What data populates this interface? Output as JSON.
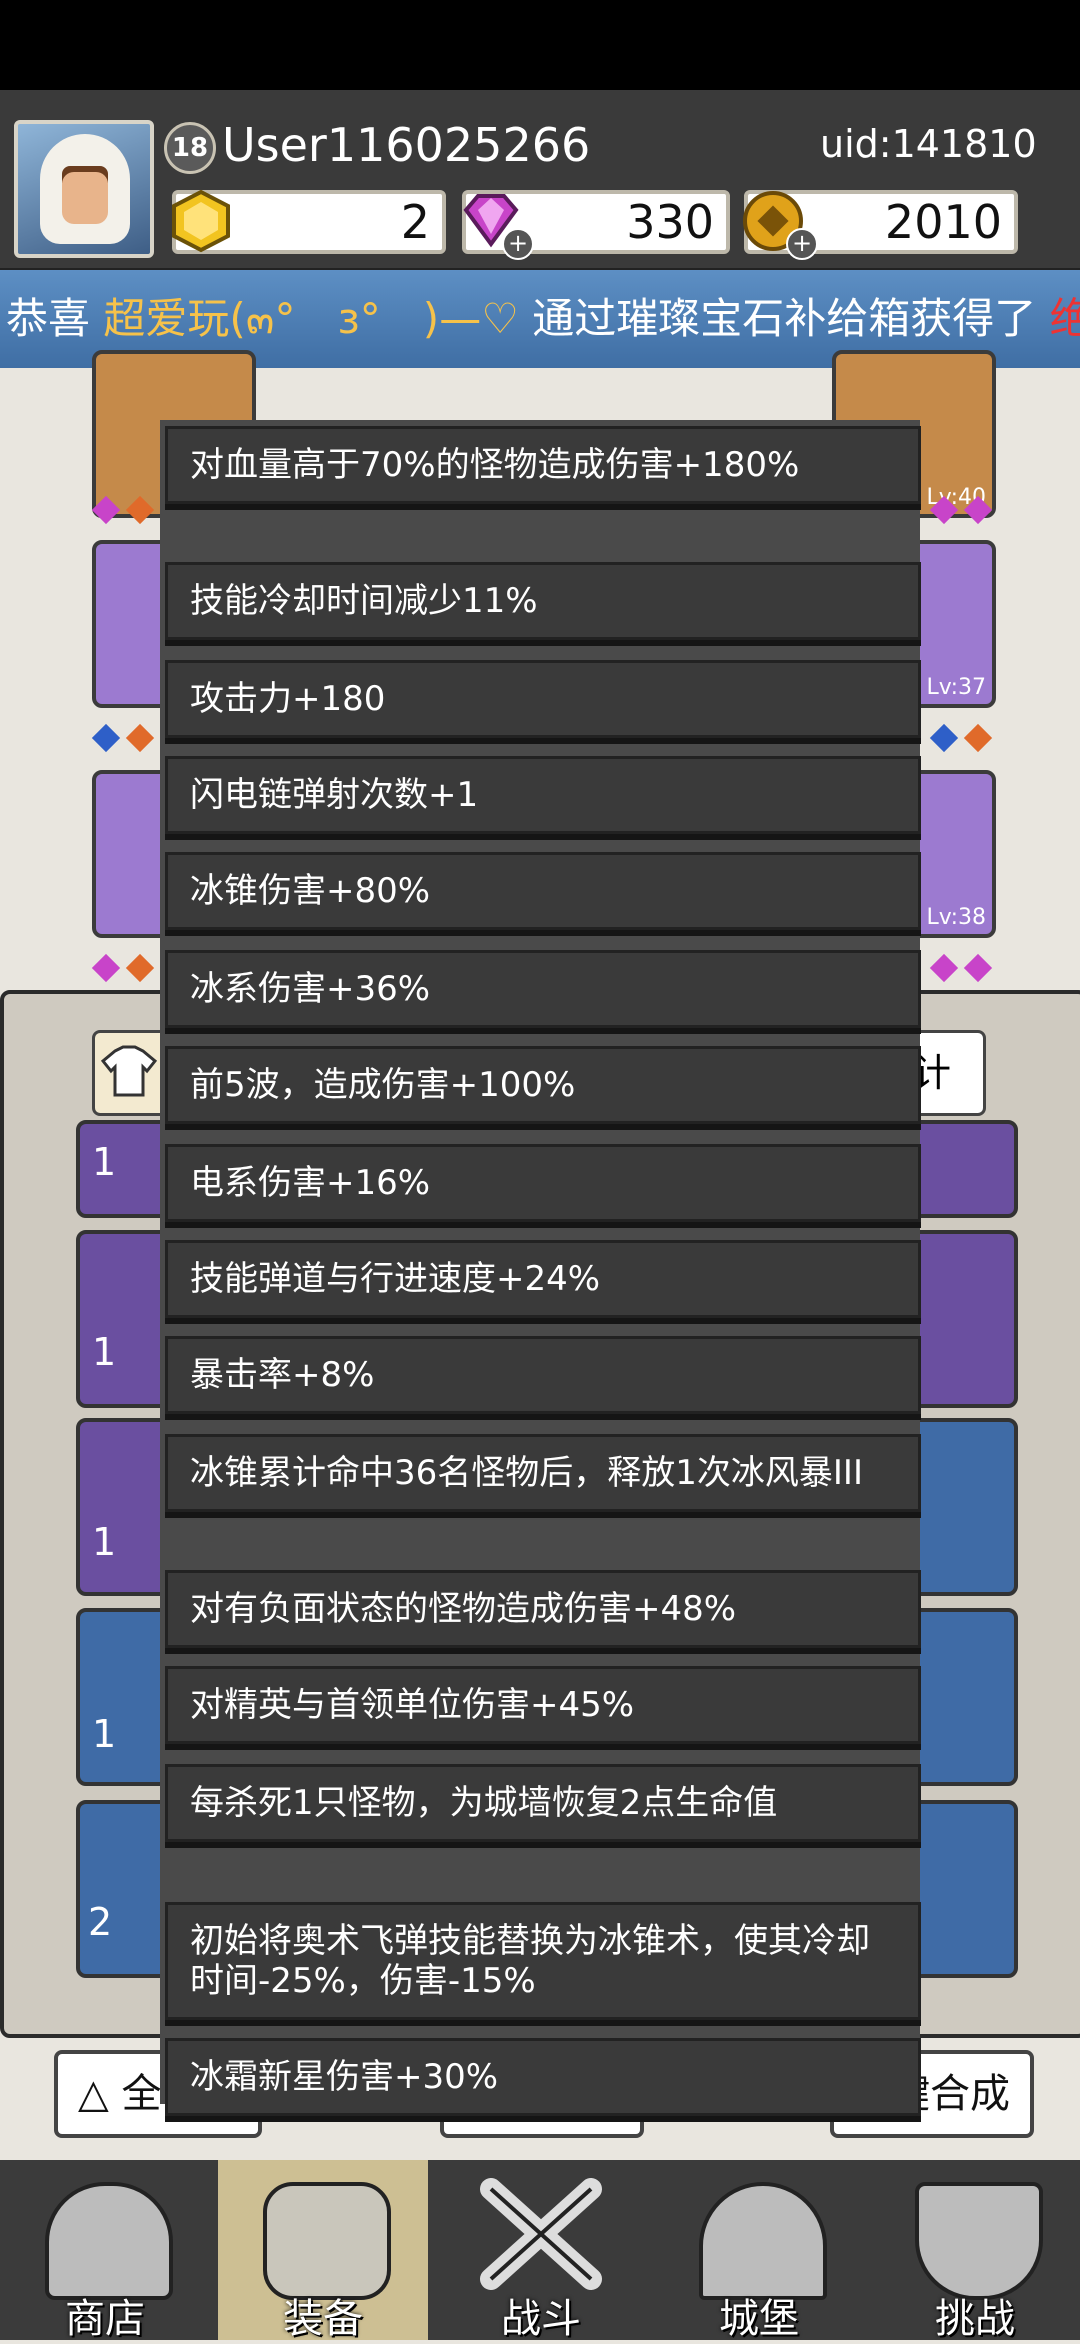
{
  "header": {
    "level": "18",
    "username": "User116025266",
    "uid": "uid:141810",
    "resources": {
      "gold_gem": "2",
      "diamond": "330",
      "coin": "2010"
    },
    "colors": {
      "gold": "#f2c420",
      "diamond": "#c844c9",
      "coin": "#e0a21a"
    }
  },
  "marquee": {
    "prefix": "恭喜",
    "player": "超爱玩(๓°　з°　)—♡",
    "suffix": "通过璀璨宝石补给箱获得了",
    "tail": "绝"
  },
  "equipment_levels": [
    "Lv:40",
    "Lv:37",
    "Lv:38"
  ],
  "panel_partial": {
    "right_tab": "计",
    "bottom_right": "键合成",
    "bottom_left": "全部"
  },
  "inventory_counts": [
    "1",
    "1",
    "1",
    "1",
    "2"
  ],
  "attributes": [
    "对血量高于70%的怪物造成伤害+180%",
    "技能冷却时间减少11%",
    "攻击力+180",
    "闪电链弹射次数+1",
    "冰锥伤害+80%",
    "冰系伤害+36%",
    "前5波，造成伤害+100%",
    "电系伤害+16%",
    "技能弹道与行进速度+24%",
    "暴击率+8%",
    "冰锥累计命中36名怪物后，释放1次冰风暴III",
    "对有负面状态的怪物造成伤害+48%",
    "对精英与首领单位伤害+45%",
    "每杀死1只怪物，为城墙恢复2点生命值",
    "初始将奥术飞弹技能替换为冰锥术，使其冷却时间-25%，伤害-15%",
    "冰霜新星伤害+30%"
  ],
  "nav": [
    {
      "label": "商店",
      "icon": "shop-icon"
    },
    {
      "label": "装备",
      "icon": "backpack-icon"
    },
    {
      "label": "战斗",
      "icon": "crossed-swords-icon"
    },
    {
      "label": "城堡",
      "icon": "castle-icon"
    },
    {
      "label": "挑战",
      "icon": "shield-icon"
    }
  ]
}
